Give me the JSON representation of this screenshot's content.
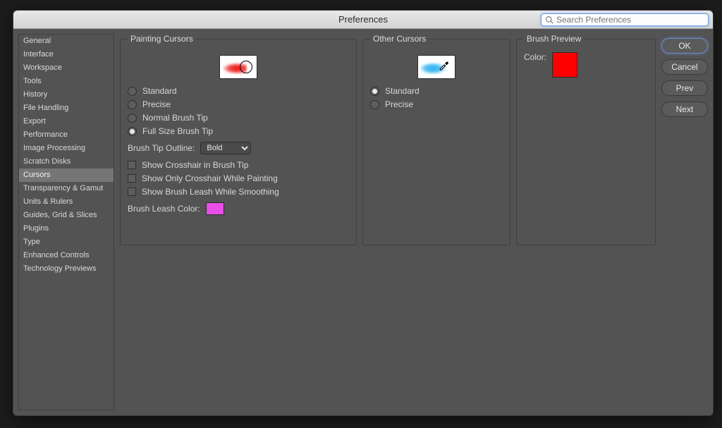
{
  "dialog": {
    "title": "Preferences",
    "search_placeholder": "Search Preferences"
  },
  "sidebar": {
    "items": [
      {
        "label": "General"
      },
      {
        "label": "Interface"
      },
      {
        "label": "Workspace"
      },
      {
        "label": "Tools"
      },
      {
        "label": "History"
      },
      {
        "label": "File Handling"
      },
      {
        "label": "Export"
      },
      {
        "label": "Performance"
      },
      {
        "label": "Image Processing"
      },
      {
        "label": "Scratch Disks"
      },
      {
        "label": "Cursors",
        "selected": true
      },
      {
        "label": "Transparency & Gamut"
      },
      {
        "label": "Units & Rulers"
      },
      {
        "label": "Guides, Grid & Slices"
      },
      {
        "label": "Plugins"
      },
      {
        "label": "Type"
      },
      {
        "label": "Enhanced Controls"
      },
      {
        "label": "Technology Previews"
      }
    ]
  },
  "paintingCursors": {
    "legend": "Painting Cursors",
    "options": {
      "standard": "Standard",
      "precise": "Precise",
      "normal": "Normal Brush Tip",
      "fullsize": "Full Size Brush Tip",
      "selected": "fullsize"
    },
    "brushTipOutline": {
      "label": "Brush Tip Outline:",
      "value": "Bold"
    },
    "checks": {
      "crosshair": "Show Crosshair in Brush Tip",
      "onlyCrosshair": "Show Only Crosshair While Painting",
      "leash": "Show Brush Leash While Smoothing"
    },
    "leashColor": {
      "label": "Brush Leash Color:",
      "hex": "#e84fe8"
    }
  },
  "otherCursors": {
    "legend": "Other Cursors",
    "options": {
      "standard": "Standard",
      "precise": "Precise",
      "selected": "standard"
    }
  },
  "brushPreview": {
    "legend": "Brush Preview",
    "colorLabel": "Color:",
    "hex": "#ff0000"
  },
  "buttons": {
    "ok": "OK",
    "cancel": "Cancel",
    "prev": "Prev",
    "next": "Next"
  }
}
